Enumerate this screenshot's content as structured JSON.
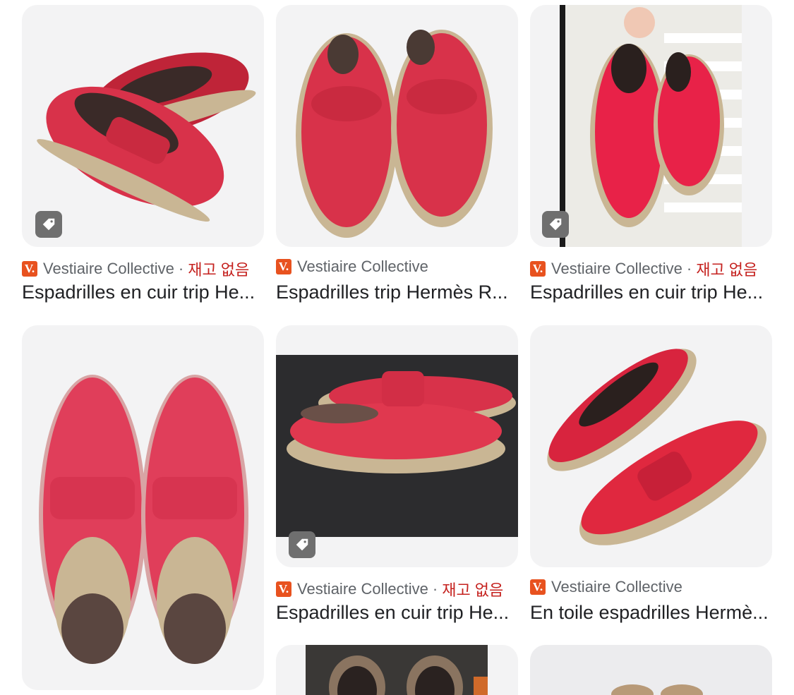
{
  "results": [
    {
      "source": "Vestiaire Collective",
      "status": "재고 없음",
      "title": "Espadrilles en cuir trip He..."
    },
    {
      "source": "Vestiaire Collective",
      "status": "",
      "title": "Espadrilles trip Hermès R..."
    },
    {
      "source": "Vestiaire Collective",
      "status": "재고 없음",
      "title": "Espadrilles en cuir trip He..."
    },
    {
      "source": "Vestiaire Collective",
      "status": "재고 없음",
      "title": "Espadrilles en cuir trip He..."
    },
    {
      "source": "Vestiaire Collective",
      "status": "",
      "title": "En toile espadrilles Hermè..."
    }
  ],
  "colors": {
    "shoe_red": "#d8324a",
    "out_of_stock": "#c5221f",
    "source_logo": "#e8521f"
  },
  "icons": {
    "tag": "price-tag-icon",
    "logo": "vestiaire-logo-icon"
  }
}
